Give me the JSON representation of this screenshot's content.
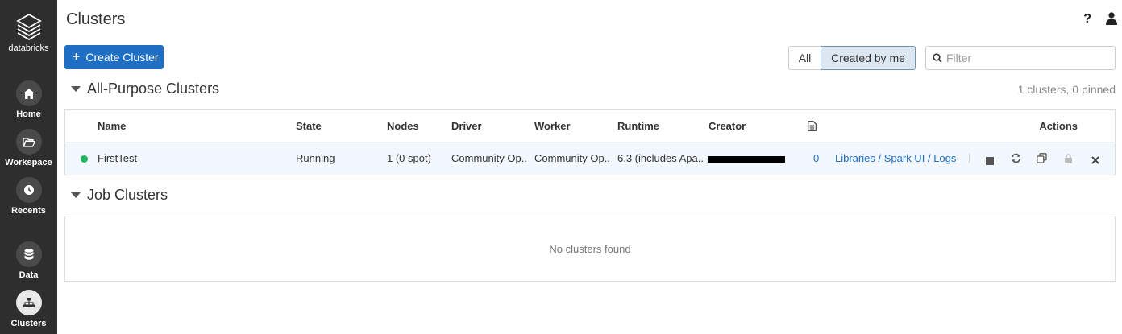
{
  "sidebar": {
    "brand": "databricks",
    "items": [
      {
        "label": "Home"
      },
      {
        "label": "Workspace"
      },
      {
        "label": "Recents"
      },
      {
        "label": "Data"
      },
      {
        "label": "Clusters"
      }
    ]
  },
  "header": {
    "title": "Clusters",
    "help": "?"
  },
  "toolbar": {
    "create_label": "Create Cluster",
    "filter_all": "All",
    "filter_mine": "Created by me",
    "filter_placeholder": "Filter"
  },
  "all_purpose": {
    "title": "All-Purpose Clusters",
    "summary": "1 clusters, 0 pinned",
    "columns": [
      "Name",
      "State",
      "Nodes",
      "Driver",
      "Worker",
      "Runtime",
      "Creator",
      "",
      "Actions"
    ],
    "rows": [
      {
        "name": "FirstTest",
        "state": "Running",
        "nodes": "1 (0 spot)",
        "driver": "Community Op..",
        "worker": "Community Op..",
        "runtime": "6.3 (includes Apa..",
        "creator": "",
        "notebooks": "0",
        "links": {
          "libraries": "Libraries",
          "sparkui": "Spark UI",
          "logs": "Logs",
          "sep": "/"
        },
        "status_color": "#1db35c"
      }
    ]
  },
  "job_clusters": {
    "title": "Job Clusters",
    "empty": "No clusters found"
  },
  "colors": {
    "sidebar": "#2e2e2e",
    "accent": "#1f6fc4",
    "running": "#1db35c"
  }
}
